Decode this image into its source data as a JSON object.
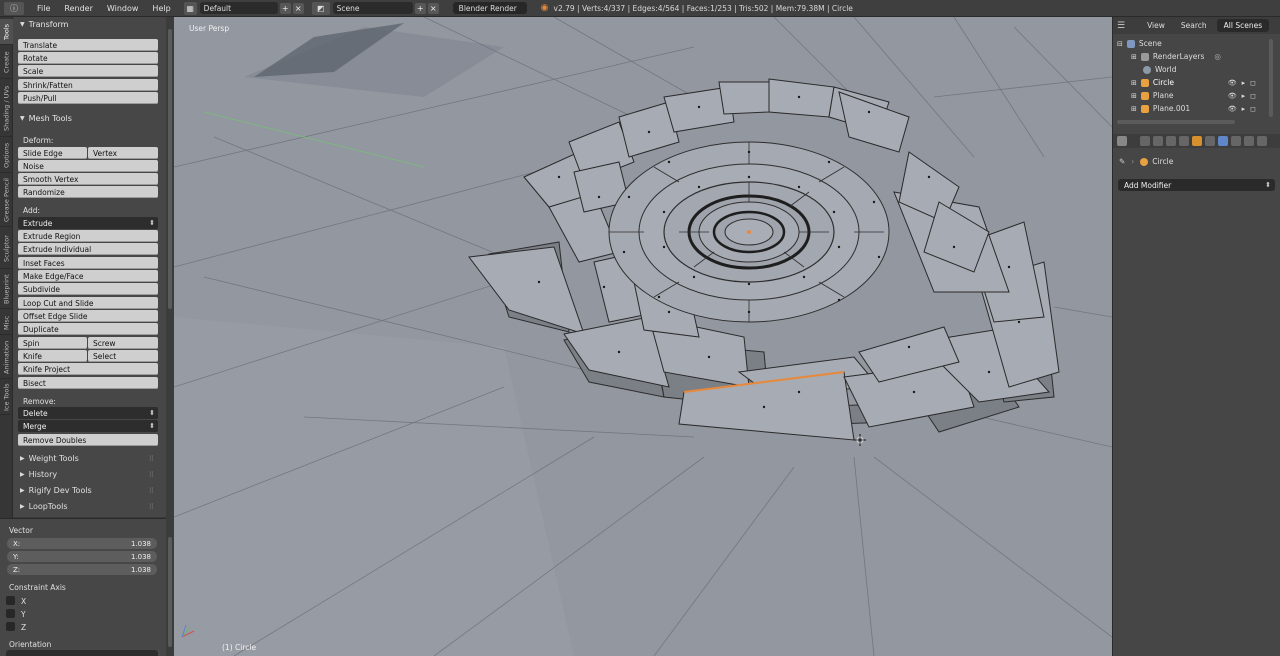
{
  "header": {
    "menus": [
      "File",
      "Render",
      "Window",
      "Help"
    ],
    "layout": "Default",
    "scene": "Scene",
    "engine": "Blender Render",
    "stats": "v2.79 | Verts:4/337 | Edges:4/564 | Faces:1/253 | Tris:502 | Mem:79.38M | Circle"
  },
  "tabs": [
    "Tools",
    "Create",
    "Shading / UVs",
    "Options",
    "Grease Pencil",
    "Sculptor",
    "Blueprint",
    "Misc",
    "Animation",
    "Ice Tools"
  ],
  "transform": {
    "title": "Transform",
    "buttons": [
      "Translate",
      "Rotate",
      "Scale",
      "Shrink/Fatten",
      "Push/Pull"
    ]
  },
  "mesh_tools": {
    "title": "Mesh Tools",
    "deform_label": "Deform:",
    "slide_edge": "Slide Edge",
    "vertex": "Vertex",
    "noise": "Noise",
    "smooth_vertex": "Smooth Vertex",
    "randomize": "Randomize",
    "add_label": "Add:",
    "extrude_menu": "Extrude",
    "extrude_region": "Extrude Region",
    "extrude_individual": "Extrude Individual",
    "inset_faces": "Inset Faces",
    "make_edge_face": "Make Edge/Face",
    "subdivide": "Subdivide",
    "loop_cut": "Loop Cut and Slide",
    "offset_edge": "Offset Edge Slide",
    "duplicate": "Duplicate",
    "spin": "Spin",
    "screw": "Screw",
    "knife": "Knife",
    "select": "Select",
    "knife_project": "Knife Project",
    "bisect": "Bisect",
    "remove_label": "Remove:",
    "delete_menu": "Delete",
    "merge_menu": "Merge",
    "remove_doubles": "Remove Doubles"
  },
  "collapsed_panels": [
    "Weight Tools",
    "History",
    "Rigify Dev Tools",
    "LoopTools"
  ],
  "operator": {
    "vector_label": "Vector",
    "x_label": "X:",
    "x": "1.038",
    "y_label": "Y:",
    "y": "1.038",
    "z_label": "Z:",
    "z": "1.038",
    "constraint_label": "Constraint Axis",
    "axis_x": "X",
    "axis_y": "Y",
    "axis_z": "Z",
    "orientation_label": "Orientation"
  },
  "viewport": {
    "view_name": "User Persp",
    "object_name": "(1) Circle"
  },
  "outliner": {
    "view": "View",
    "search": "Search",
    "all_scenes": "All Scenes",
    "scene": "Scene",
    "render_layers": "RenderLayers",
    "world": "World",
    "circle": "Circle",
    "plane": "Plane",
    "plane001": "Plane.001"
  },
  "properties": {
    "object": "Circle",
    "add_modifier": "Add Modifier"
  }
}
